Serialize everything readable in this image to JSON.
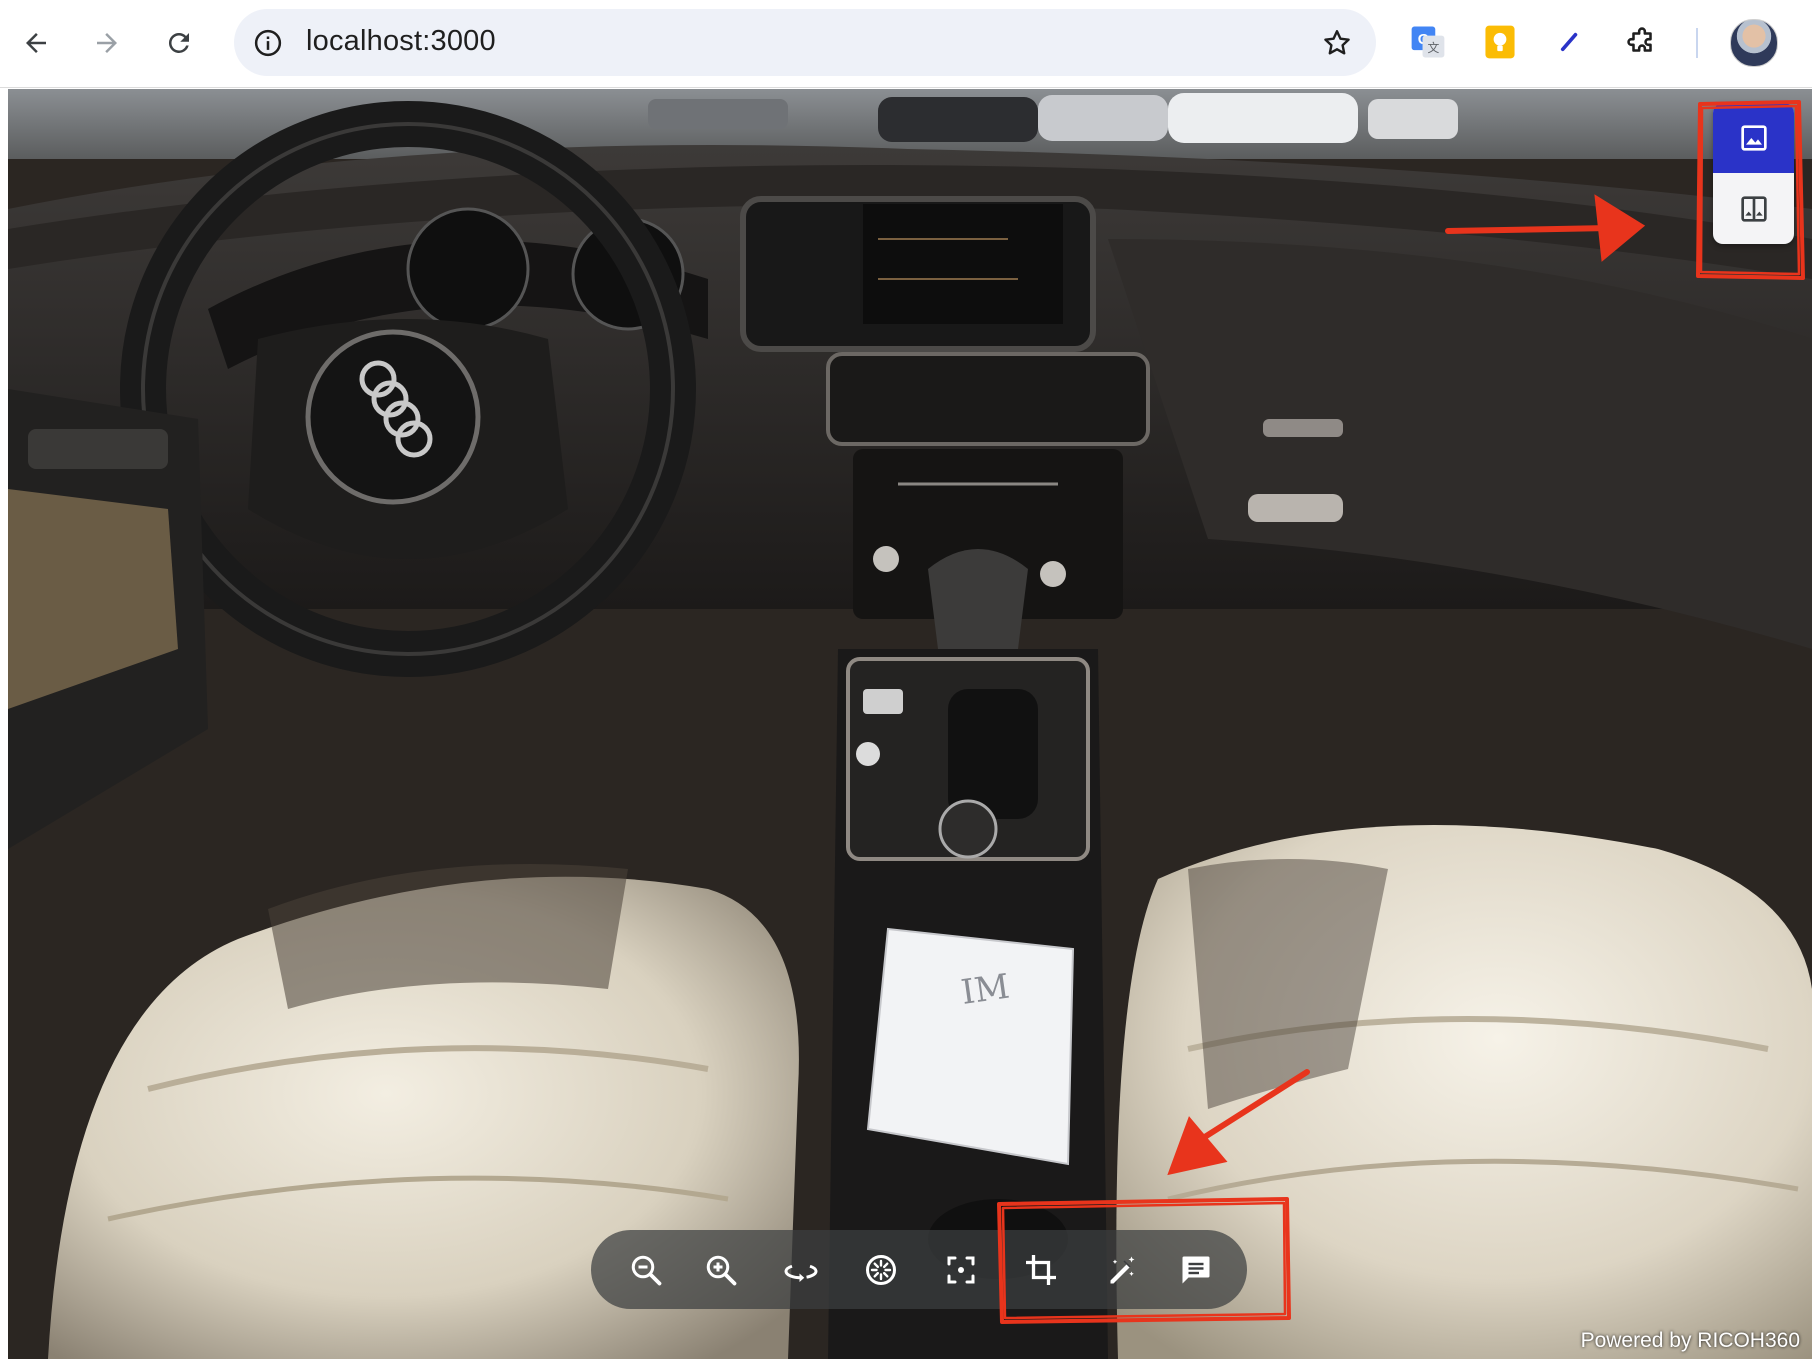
{
  "browser": {
    "url": "localhost:3000",
    "nav": {
      "back_icon": "arrow-left-icon",
      "forward_icon": "arrow-right-icon",
      "reload_icon": "reload-icon"
    },
    "omnibox_icons": [
      "site-info-icon",
      "star-icon"
    ],
    "extensions": [
      "google-translate-icon",
      "keep-notes-icon",
      "pen-extension-icon",
      "puzzle-extensions-icon"
    ],
    "profile": "avatar"
  },
  "viewer": {
    "side_panel": {
      "buttons": [
        {
          "name": "single-image-view",
          "icon": "image-icon",
          "active": true
        },
        {
          "name": "split-view",
          "icon": "split-layout-icon",
          "active": false
        }
      ]
    },
    "toolbar": {
      "buttons": [
        {
          "name": "zoom-out",
          "icon": "zoom-out-icon"
        },
        {
          "name": "zoom-in",
          "icon": "zoom-in-icon"
        },
        {
          "name": "rotate",
          "icon": "rotate-360-icon"
        },
        {
          "name": "autoplay",
          "icon": "spin-dial-icon"
        },
        {
          "name": "fullscreen",
          "icon": "fullscreen-icon"
        },
        {
          "name": "crop",
          "icon": "crop-icon"
        },
        {
          "name": "edit-annotate",
          "icon": "magic-edit-icon"
        },
        {
          "name": "comment",
          "icon": "comment-icon"
        }
      ]
    },
    "powered_by": "Powered by RICOH360",
    "handwritten_note": "IM"
  },
  "colors": {
    "accent": "#2a33c8",
    "annotation": "#e8341c",
    "toolbar_bg": "#3c3e40"
  }
}
